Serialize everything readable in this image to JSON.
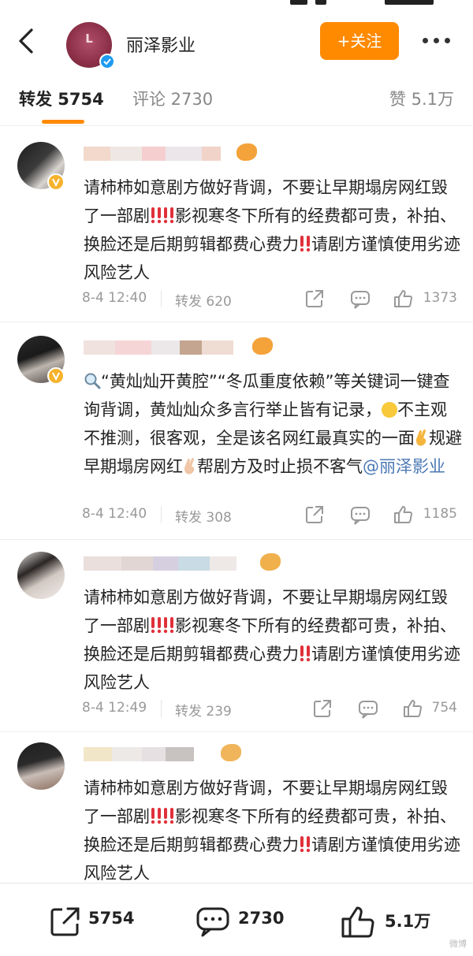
{
  "account": {
    "name": "丽泽影业",
    "follow_label": "+关注"
  },
  "tabs": {
    "repost": "转发 5754",
    "comment": "评论 2730",
    "like": "赞 5.1万"
  },
  "reposts": [
    {
      "segments": [
        "请柿柿如意剧方做好背调，不要让早期塌房网红毁了一部剧",
        "!!",
        "!!",
        "影视寒冬下所有的经费都可贵，补拍、换脸还是后期剪辑都费心费力",
        "!!",
        "请剧方谨慎使用劣迹风险艺人"
      ],
      "time": "8-4 12:40",
      "repost_count": "转发 620",
      "like_count": "1373"
    },
    {
      "segments": [
        "“黄灿灿开黄腔”“冬瓜重度依赖”等关键词一键查询背调，黄灿灿众多言行举止皆有记录，",
        "不主观不推测，很客观，全是该名网红最真实的一面",
        "规避早期塌房网红",
        "帮剧方及时止损不客气",
        "@丽泽影业"
      ],
      "time": "8-4 12:40",
      "repost_count": "转发 308",
      "like_count": "1185"
    },
    {
      "segments": [
        "请柿柿如意剧方做好背调，不要让早期塌房网红毁了一部剧",
        "!!",
        "!!",
        "影视寒冬下所有的经费都可贵，补拍、换脸还是后期剪辑都费心费力",
        "!!",
        "请剧方谨慎使用劣迹风险艺人"
      ],
      "time": "8-4 12:49",
      "repost_count": "转发 239",
      "like_count": "754"
    },
    {
      "segments": [
        "请柿柿如意剧方做好背调，不要让早期塌房网红毁了一部剧",
        "!!",
        "!!",
        "影视寒冬下所有的经费都可贵，补拍、换脸还是后期剪辑都费心费力",
        "!!",
        "请剧方谨慎使用劣迹风险艺人"
      ]
    }
  ],
  "bottom_bar": {
    "repost": "5754",
    "comment": "2730",
    "like": "5.1万"
  },
  "colors": {
    "accent": "#ff8a00",
    "mention": "#4a78b5",
    "verified": "#1e9bf0",
    "badge": "#f7b22c",
    "double_exclaim": "#e0303a"
  },
  "icons": [
    "back-icon",
    "verified-icon",
    "more-icon",
    "share-icon",
    "comment-icon",
    "like-icon",
    "search-icon",
    "laugh-emoji",
    "crossed-fingers-emoji",
    "double-exclamation-emoji"
  ]
}
